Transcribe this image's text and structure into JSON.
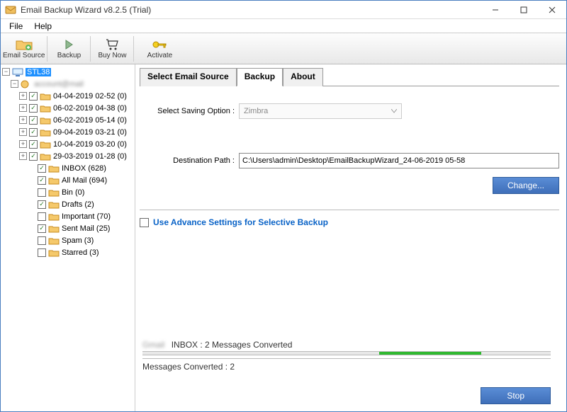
{
  "window": {
    "title": "Email Backup Wizard v8.2.5 (Trial)"
  },
  "menu": {
    "file": "File",
    "help": "Help"
  },
  "toolbar": {
    "email_source": "Email Source",
    "backup": "Backup",
    "buy_now": "Buy Now",
    "activate": "Activate"
  },
  "tree": {
    "root": "STL38",
    "account": "",
    "items": [
      {
        "label": "04-04-2019 02-52 (0)",
        "exp": "+",
        "chk": true
      },
      {
        "label": "06-02-2019 04-38 (0)",
        "exp": "+",
        "chk": true
      },
      {
        "label": "06-02-2019 05-14 (0)",
        "exp": "+",
        "chk": true
      },
      {
        "label": "09-04-2019 03-21 (0)",
        "exp": "+",
        "chk": true
      },
      {
        "label": "10-04-2019 03-20 (0)",
        "exp": "+",
        "chk": true
      },
      {
        "label": "29-03-2019 01-28 (0)",
        "exp": "+",
        "chk": true
      }
    ],
    "folders": [
      {
        "label": "INBOX (628)",
        "chk": true
      },
      {
        "label": "All Mail (694)",
        "chk": true
      },
      {
        "label": "Bin (0)",
        "chk": false
      },
      {
        "label": "Drafts (2)",
        "chk": true
      },
      {
        "label": "Important (70)",
        "chk": false
      },
      {
        "label": "Sent Mail (25)",
        "chk": true
      },
      {
        "label": "Spam (3)",
        "chk": false
      },
      {
        "label": "Starred (3)",
        "chk": false
      }
    ]
  },
  "tabs": {
    "select_source": "Select Email Source",
    "backup": "Backup",
    "about": "About"
  },
  "form": {
    "saving_label": "Select Saving Option :",
    "saving_value": "Zimbra",
    "dest_label": "Destination Path :",
    "dest_value": "C:\\Users\\admin\\Desktop\\EmailBackupWizard_24-06-2019 05-58",
    "change": "Change...",
    "advance": "Use Advance Settings for Selective Backup"
  },
  "progress": {
    "source_blur": "Gmail",
    "folder_status": "INBOX : 2 Messages Converted",
    "fill_left_pct": 58,
    "fill_width_pct": 25,
    "count_line": "Messages Converted : 2"
  },
  "buttons": {
    "stop": "Stop"
  }
}
